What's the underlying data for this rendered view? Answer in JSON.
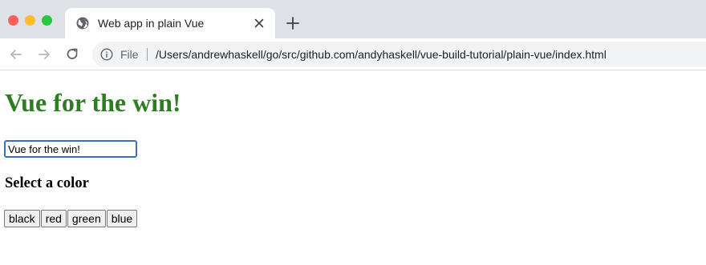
{
  "window": {
    "traffic_lights": [
      "close",
      "minimize",
      "zoom"
    ]
  },
  "tab": {
    "title": "Web app in plain Vue",
    "favicon": "globe-icon"
  },
  "toolbar": {
    "scheme_label": "File",
    "url": "/Users/andrewhaskell/go/src/github.com/andyhaskell/vue-build-tutorial/plain-vue/index.html"
  },
  "page": {
    "heading": "Vue for the win!",
    "heading_color": "#2f7d23",
    "input_value": "Vue for the win!",
    "section_heading": "Select a color",
    "color_buttons": [
      "black",
      "red",
      "green",
      "blue"
    ]
  }
}
